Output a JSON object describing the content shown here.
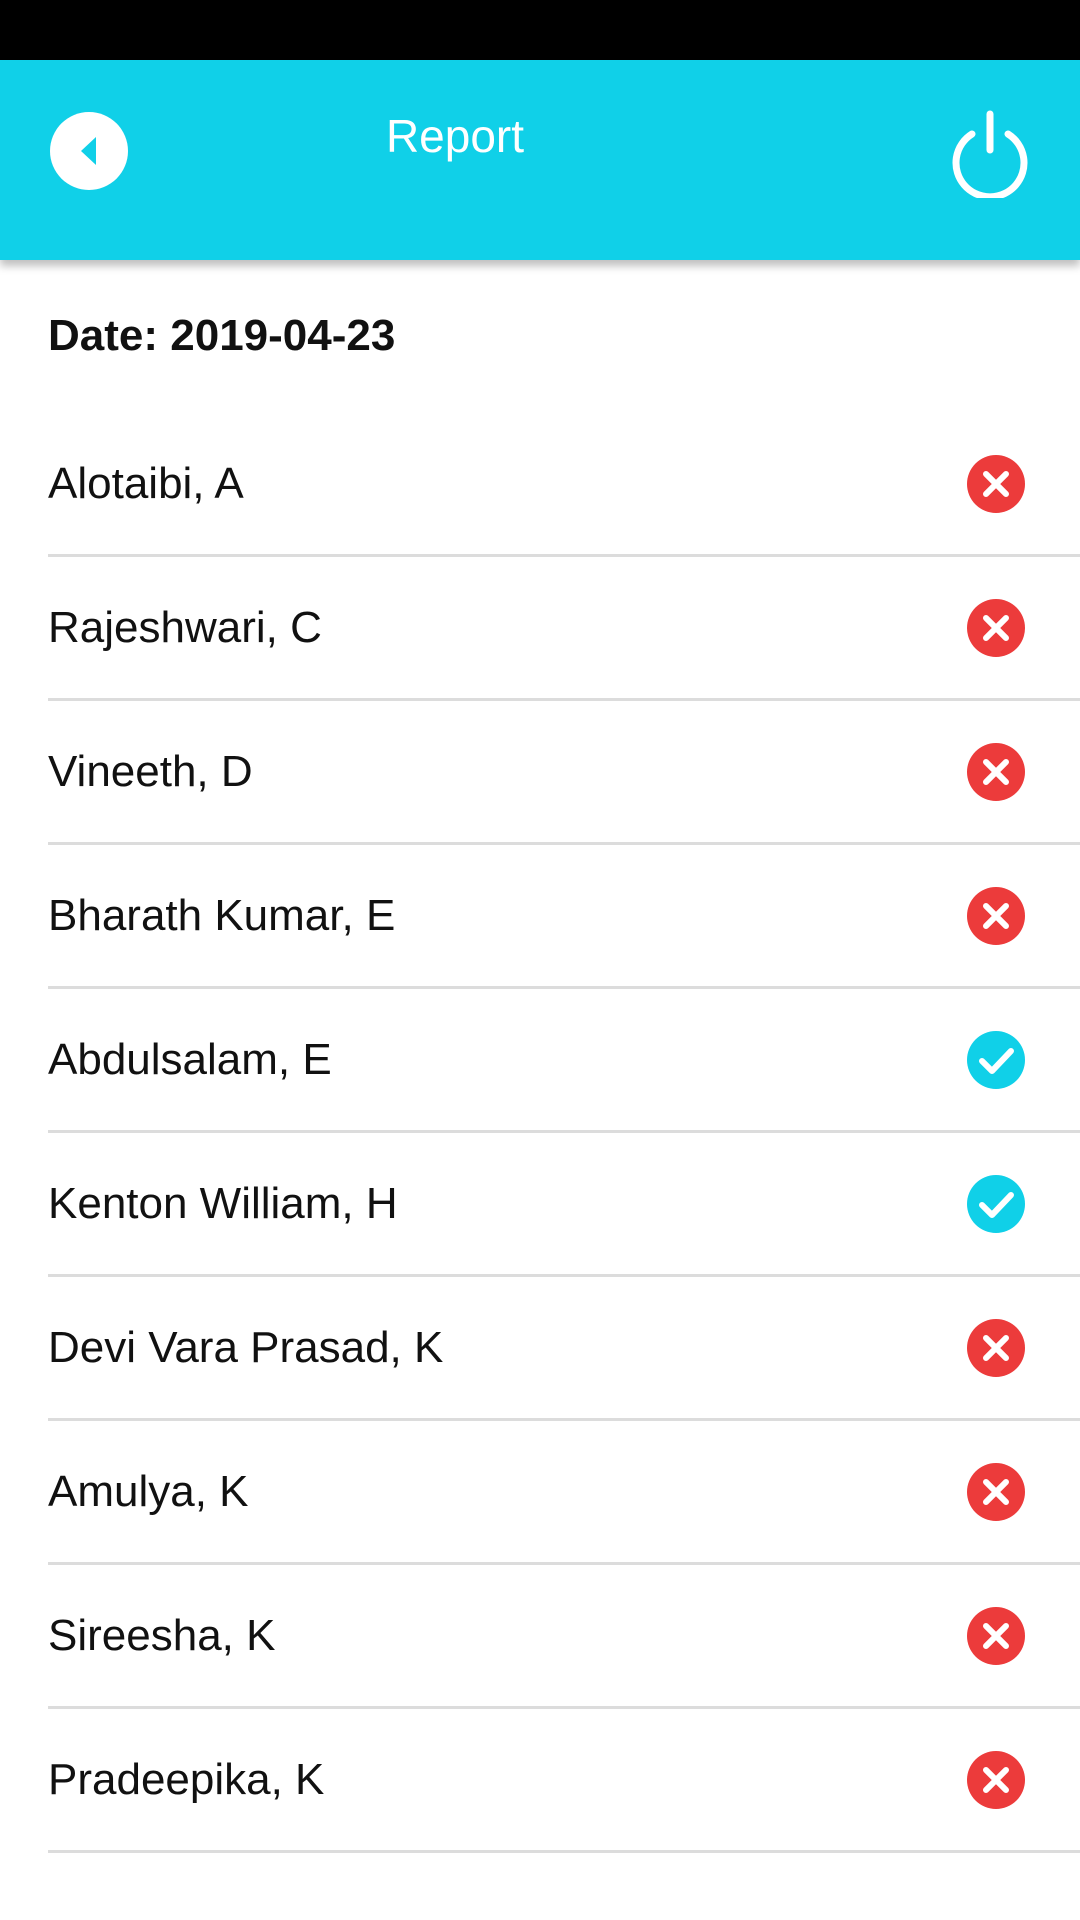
{
  "header": {
    "title": "Report",
    "background": "#10d0e8",
    "back_icon": "back-arrow-icon",
    "power_icon": "power-icon"
  },
  "report": {
    "date_text": "Date: 2019-04-23"
  },
  "colors": {
    "absent": "#ec3b3b",
    "present": "#10d0e8"
  },
  "students": [
    {
      "name": "Alotaibi, A",
      "status": "absent"
    },
    {
      "name": "Rajeshwari, C",
      "status": "absent"
    },
    {
      "name": "Vineeth, D",
      "status": "absent"
    },
    {
      "name": "Bharath Kumar, E",
      "status": "absent"
    },
    {
      "name": "Abdulsalam, E",
      "status": "present"
    },
    {
      "name": "Kenton William, H",
      "status": "present"
    },
    {
      "name": "Devi Vara Prasad, K",
      "status": "absent"
    },
    {
      "name": "Amulya, K",
      "status": "absent"
    },
    {
      "name": "Sireesha, K",
      "status": "absent"
    },
    {
      "name": "Pradeepika, K",
      "status": "absent"
    }
  ]
}
